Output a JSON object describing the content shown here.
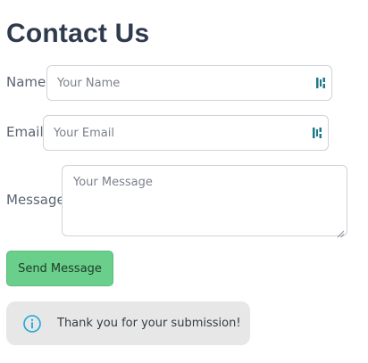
{
  "page": {
    "title": "Contact Us"
  },
  "form": {
    "name": {
      "label": "Name",
      "placeholder": "Your Name",
      "icon": "password-manager-icon"
    },
    "email": {
      "label": "Email",
      "placeholder": "Your Email",
      "icon": "password-manager-icon"
    },
    "message": {
      "label": "Message",
      "placeholder": "Your Message"
    },
    "submit_label": "Send Message"
  },
  "alert": {
    "icon": "info-icon",
    "text": "Thank you for your submission!"
  },
  "colors": {
    "button": "#69cf8b",
    "alert_background": "#e7e7e7",
    "info_icon": "#1ea7d9",
    "password_manager_icon": "#1f7a8a"
  }
}
